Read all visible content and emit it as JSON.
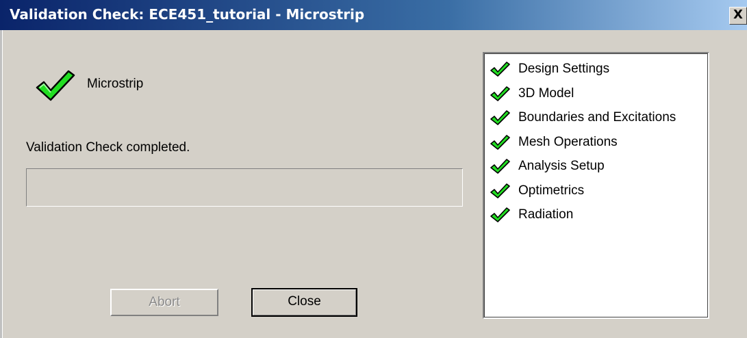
{
  "window": {
    "title": "Validation Check: ECE451_tutorial - Microstrip",
    "close_glyph": "X"
  },
  "design": {
    "name": "Microstrip",
    "icon": "green-check-icon"
  },
  "status": {
    "message": "Validation Check completed.",
    "progress": 0
  },
  "buttons": {
    "abort_label": "Abort",
    "abort_enabled": false,
    "close_label": "Close"
  },
  "checks": [
    {
      "label": "Design Settings",
      "icon": "green-check-icon"
    },
    {
      "label": "3D Model",
      "icon": "green-check-icon"
    },
    {
      "label": "Boundaries and Excitations",
      "icon": "green-check-icon"
    },
    {
      "label": "Mesh Operations",
      "icon": "green-check-icon"
    },
    {
      "label": "Analysis Setup",
      "icon": "green-check-icon"
    },
    {
      "label": "Optimetrics",
      "icon": "green-check-icon"
    },
    {
      "label": "Radiation",
      "icon": "green-check-icon"
    }
  ],
  "colors": {
    "check_fill": "#22dd22",
    "check_outline": "#000000",
    "title_bar": "#0a246a",
    "dialog_bg": "#d4d0c8"
  }
}
